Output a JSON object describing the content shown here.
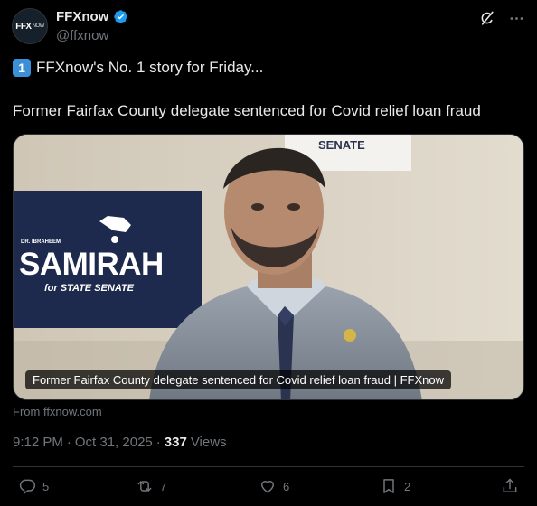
{
  "account": {
    "avatar_text": "FFX",
    "avatar_sub": "NOW",
    "display_name": "FFXnow",
    "handle": "@ffxnow"
  },
  "header_icons": [
    "grok-icon",
    "more-icon"
  ],
  "post": {
    "keycap": "1",
    "line1": "FFXnow's No. 1 story for Friday...",
    "line2": "Former Fairfax County delegate sentenced for Covid relief loan fraud"
  },
  "card": {
    "sign_top": "SENATE",
    "sign_small": "DR. IBRAHEEM",
    "sign_name": "SAMIRAH",
    "sign_sub": "for STATE SENATE",
    "caption": "Former Fairfax County delegate sentenced for Covid relief loan fraud | FFXnow",
    "source": "From ffxnow.com"
  },
  "meta": {
    "time": "9:12 PM",
    "dot1": "·",
    "date": "Oct 31, 2025",
    "dot2": "·",
    "views_count": "337",
    "views_label": "Views"
  },
  "actions": {
    "replies": "5",
    "reposts": "7",
    "likes": "6",
    "bookmarks": "2"
  },
  "colors": {
    "background": "#000000",
    "text": "#e7e9ea",
    "muted": "#71767b",
    "verified": "#1d9bf0",
    "border": "#2f3336"
  }
}
